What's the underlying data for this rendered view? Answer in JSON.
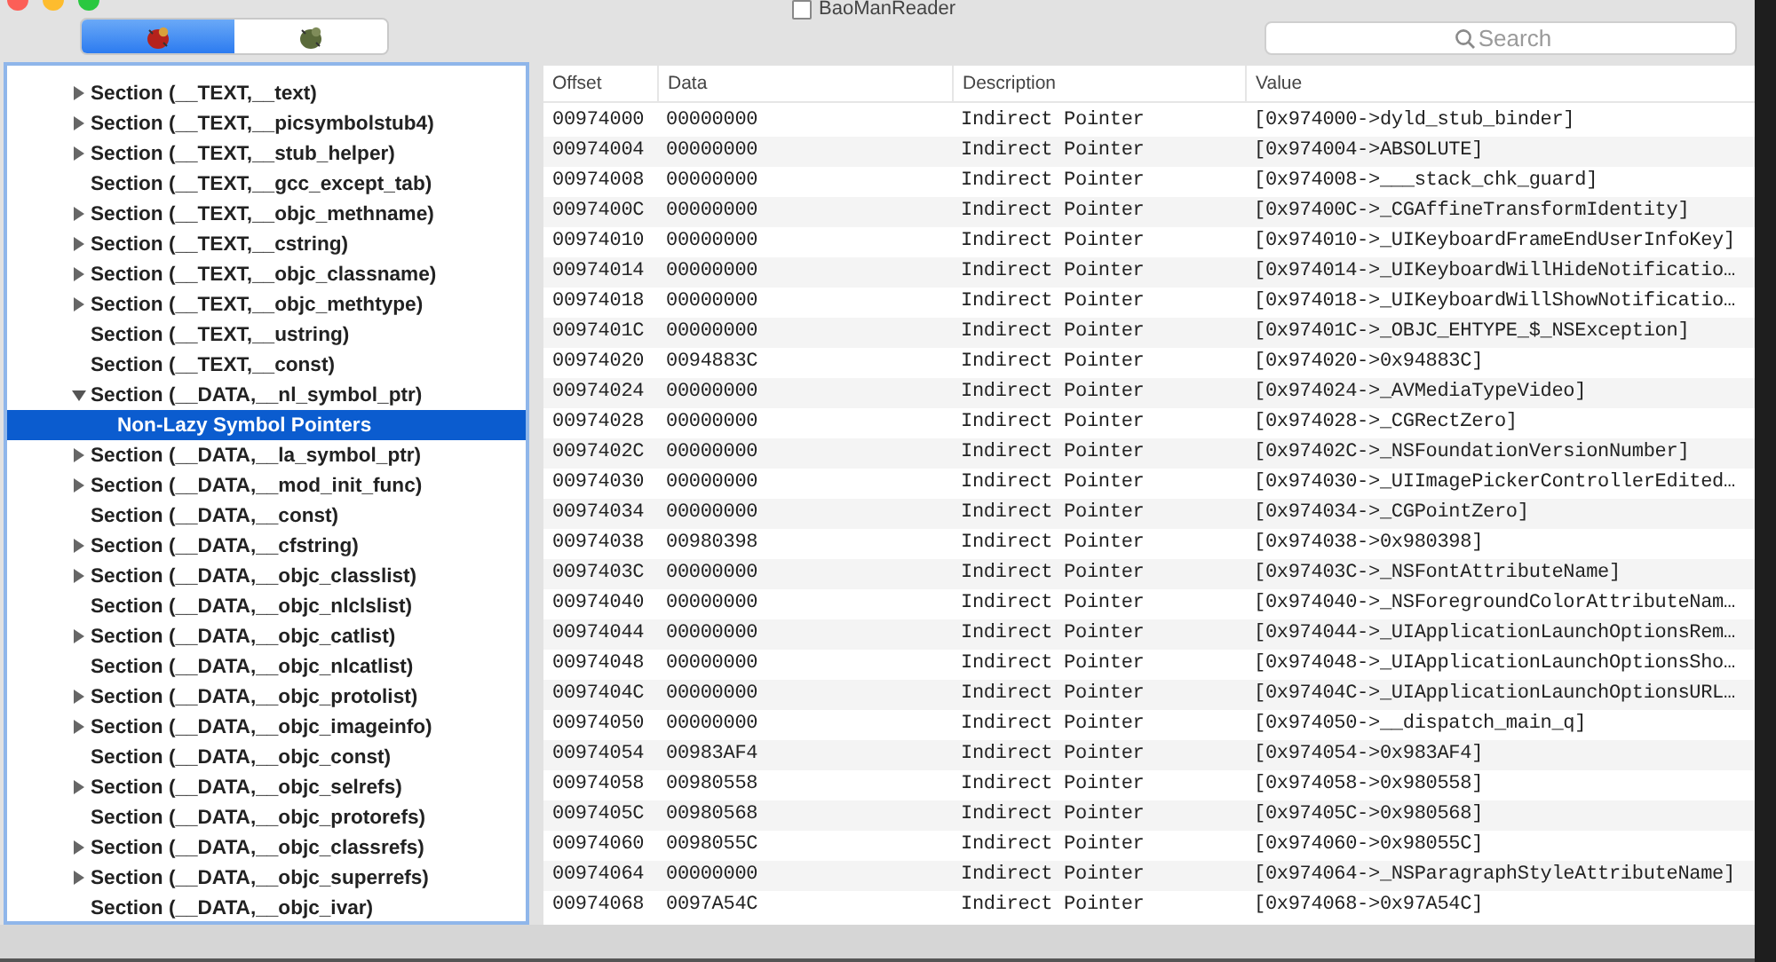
{
  "window": {
    "title": "BaoManReader"
  },
  "tabs": [
    {
      "selected": true
    },
    {
      "selected": false
    }
  ],
  "search": {
    "placeholder": "Search"
  },
  "tree": [
    {
      "label": "Section (__TEXT,__text)",
      "kind": "folder",
      "expanded": false,
      "selected": false
    },
    {
      "label": "Section (__TEXT,__picsymbolstub4)",
      "kind": "folder",
      "expanded": false,
      "selected": false
    },
    {
      "label": "Section (__TEXT,__stub_helper)",
      "kind": "folder",
      "expanded": false,
      "selected": false
    },
    {
      "label": "Section (__TEXT,__gcc_except_tab)",
      "kind": "leaf",
      "selected": false
    },
    {
      "label": "Section (__TEXT,__objc_methname)",
      "kind": "folder",
      "expanded": false,
      "selected": false
    },
    {
      "label": "Section (__TEXT,__cstring)",
      "kind": "folder",
      "expanded": false,
      "selected": false
    },
    {
      "label": "Section (__TEXT,__objc_classname)",
      "kind": "folder",
      "expanded": false,
      "selected": false
    },
    {
      "label": "Section (__TEXT,__objc_methtype)",
      "kind": "folder",
      "expanded": false,
      "selected": false
    },
    {
      "label": "Section (__TEXT,__ustring)",
      "kind": "leaf",
      "selected": false
    },
    {
      "label": "Section (__TEXT,__const)",
      "kind": "leaf",
      "selected": false
    },
    {
      "label": "Section (__DATA,__nl_symbol_ptr)",
      "kind": "folder",
      "expanded": true,
      "selected": false,
      "children": [
        {
          "label": "Non-Lazy Symbol Pointers",
          "kind": "leaf",
          "selected": true
        }
      ]
    },
    {
      "label": "Section (__DATA,__la_symbol_ptr)",
      "kind": "folder",
      "expanded": false,
      "selected": false
    },
    {
      "label": "Section (__DATA,__mod_init_func)",
      "kind": "folder",
      "expanded": false,
      "selected": false
    },
    {
      "label": "Section (__DATA,__const)",
      "kind": "leaf",
      "selected": false
    },
    {
      "label": "Section (__DATA,__cfstring)",
      "kind": "folder",
      "expanded": false,
      "selected": false
    },
    {
      "label": "Section (__DATA,__objc_classlist)",
      "kind": "folder",
      "expanded": false,
      "selected": false
    },
    {
      "label": "Section (__DATA,__objc_nlclslist)",
      "kind": "leaf",
      "selected": false
    },
    {
      "label": "Section (__DATA,__objc_catlist)",
      "kind": "folder",
      "expanded": false,
      "selected": false
    },
    {
      "label": "Section (__DATA,__objc_nlcatlist)",
      "kind": "leaf",
      "selected": false
    },
    {
      "label": "Section (__DATA,__objc_protolist)",
      "kind": "folder",
      "expanded": false,
      "selected": false
    },
    {
      "label": "Section (__DATA,__objc_imageinfo)",
      "kind": "folder",
      "expanded": false,
      "selected": false
    },
    {
      "label": "Section (__DATA,__objc_const)",
      "kind": "leaf",
      "selected": false
    },
    {
      "label": "Section (__DATA,__objc_selrefs)",
      "kind": "folder",
      "expanded": false,
      "selected": false
    },
    {
      "label": "Section (__DATA,__objc_protorefs)",
      "kind": "leaf",
      "selected": false
    },
    {
      "label": "Section (__DATA,__objc_classrefs)",
      "kind": "folder",
      "expanded": false,
      "selected": false
    },
    {
      "label": "Section (__DATA,__objc_superrefs)",
      "kind": "folder",
      "expanded": false,
      "selected": false
    },
    {
      "label": "Section (__DATA,__objc_ivar)",
      "kind": "leaf",
      "selected": false
    }
  ],
  "table": {
    "columns": [
      "Offset",
      "Data",
      "Description",
      "Value"
    ],
    "rows": [
      [
        "00974000",
        "00000000",
        "Indirect Pointer",
        "[0x974000->dyld_stub_binder]"
      ],
      [
        "00974004",
        "00000000",
        "Indirect Pointer",
        "[0x974004->ABSOLUTE]"
      ],
      [
        "00974008",
        "00000000",
        "Indirect Pointer",
        "[0x974008->___stack_chk_guard]"
      ],
      [
        "0097400C",
        "00000000",
        "Indirect Pointer",
        "[0x97400C->_CGAffineTransformIdentity]"
      ],
      [
        "00974010",
        "00000000",
        "Indirect Pointer",
        "[0x974010->_UIKeyboardFrameEndUserInfoKey]"
      ],
      [
        "00974014",
        "00000000",
        "Indirect Pointer",
        "[0x974014->_UIKeyboardWillHideNotificatio…"
      ],
      [
        "00974018",
        "00000000",
        "Indirect Pointer",
        "[0x974018->_UIKeyboardWillShowNotificatio…"
      ],
      [
        "0097401C",
        "00000000",
        "Indirect Pointer",
        "[0x97401C->_OBJC_EHTYPE_$_NSException]"
      ],
      [
        "00974020",
        "0094883C",
        "Indirect Pointer",
        "[0x974020->0x94883C]"
      ],
      [
        "00974024",
        "00000000",
        "Indirect Pointer",
        "[0x974024->_AVMediaTypeVideo]"
      ],
      [
        "00974028",
        "00000000",
        "Indirect Pointer",
        "[0x974028->_CGRectZero]"
      ],
      [
        "0097402C",
        "00000000",
        "Indirect Pointer",
        "[0x97402C->_NSFoundationVersionNumber]"
      ],
      [
        "00974030",
        "00000000",
        "Indirect Pointer",
        "[0x974030->_UIImagePickerControllerEdited…"
      ],
      [
        "00974034",
        "00000000",
        "Indirect Pointer",
        "[0x974034->_CGPointZero]"
      ],
      [
        "00974038",
        "00980398",
        "Indirect Pointer",
        "[0x974038->0x980398]"
      ],
      [
        "0097403C",
        "00000000",
        "Indirect Pointer",
        "[0x97403C->_NSFontAttributeName]"
      ],
      [
        "00974040",
        "00000000",
        "Indirect Pointer",
        "[0x974040->_NSForegroundColorAttributeNam…"
      ],
      [
        "00974044",
        "00000000",
        "Indirect Pointer",
        "[0x974044->_UIApplicationLaunchOptionsRem…"
      ],
      [
        "00974048",
        "00000000",
        "Indirect Pointer",
        "[0x974048->_UIApplicationLaunchOptionsSho…"
      ],
      [
        "0097404C",
        "00000000",
        "Indirect Pointer",
        "[0x97404C->_UIApplicationLaunchOptionsURL…"
      ],
      [
        "00974050",
        "00000000",
        "Indirect Pointer",
        "[0x974050->__dispatch_main_q]"
      ],
      [
        "00974054",
        "00983AF4",
        "Indirect Pointer",
        "[0x974054->0x983AF4]"
      ],
      [
        "00974058",
        "00980558",
        "Indirect Pointer",
        "[0x974058->0x980558]"
      ],
      [
        "0097405C",
        "00980568",
        "Indirect Pointer",
        "[0x97405C->0x980568]"
      ],
      [
        "00974060",
        "0098055C",
        "Indirect Pointer",
        "[0x974060->0x98055C]"
      ],
      [
        "00974064",
        "00000000",
        "Indirect Pointer",
        "[0x974064->_NSParagraphStyleAttributeName]"
      ],
      [
        "00974068",
        "0097A54C",
        "Indirect Pointer",
        "[0x974068->0x97A54C]"
      ]
    ]
  }
}
